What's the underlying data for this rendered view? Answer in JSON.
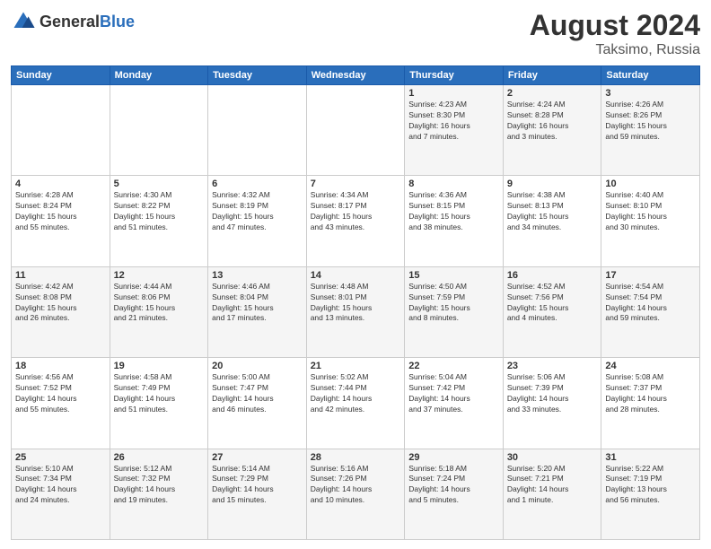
{
  "header": {
    "logo_general": "General",
    "logo_blue": "Blue",
    "month_year": "August 2024",
    "location": "Taksimo, Russia"
  },
  "weekdays": [
    "Sunday",
    "Monday",
    "Tuesday",
    "Wednesday",
    "Thursday",
    "Friday",
    "Saturday"
  ],
  "weeks": [
    [
      {
        "day": "",
        "info": ""
      },
      {
        "day": "",
        "info": ""
      },
      {
        "day": "",
        "info": ""
      },
      {
        "day": "",
        "info": ""
      },
      {
        "day": "1",
        "info": "Sunrise: 4:23 AM\nSunset: 8:30 PM\nDaylight: 16 hours\nand 7 minutes."
      },
      {
        "day": "2",
        "info": "Sunrise: 4:24 AM\nSunset: 8:28 PM\nDaylight: 16 hours\nand 3 minutes."
      },
      {
        "day": "3",
        "info": "Sunrise: 4:26 AM\nSunset: 8:26 PM\nDaylight: 15 hours\nand 59 minutes."
      }
    ],
    [
      {
        "day": "4",
        "info": "Sunrise: 4:28 AM\nSunset: 8:24 PM\nDaylight: 15 hours\nand 55 minutes."
      },
      {
        "day": "5",
        "info": "Sunrise: 4:30 AM\nSunset: 8:22 PM\nDaylight: 15 hours\nand 51 minutes."
      },
      {
        "day": "6",
        "info": "Sunrise: 4:32 AM\nSunset: 8:19 PM\nDaylight: 15 hours\nand 47 minutes."
      },
      {
        "day": "7",
        "info": "Sunrise: 4:34 AM\nSunset: 8:17 PM\nDaylight: 15 hours\nand 43 minutes."
      },
      {
        "day": "8",
        "info": "Sunrise: 4:36 AM\nSunset: 8:15 PM\nDaylight: 15 hours\nand 38 minutes."
      },
      {
        "day": "9",
        "info": "Sunrise: 4:38 AM\nSunset: 8:13 PM\nDaylight: 15 hours\nand 34 minutes."
      },
      {
        "day": "10",
        "info": "Sunrise: 4:40 AM\nSunset: 8:10 PM\nDaylight: 15 hours\nand 30 minutes."
      }
    ],
    [
      {
        "day": "11",
        "info": "Sunrise: 4:42 AM\nSunset: 8:08 PM\nDaylight: 15 hours\nand 26 minutes."
      },
      {
        "day": "12",
        "info": "Sunrise: 4:44 AM\nSunset: 8:06 PM\nDaylight: 15 hours\nand 21 minutes."
      },
      {
        "day": "13",
        "info": "Sunrise: 4:46 AM\nSunset: 8:04 PM\nDaylight: 15 hours\nand 17 minutes."
      },
      {
        "day": "14",
        "info": "Sunrise: 4:48 AM\nSunset: 8:01 PM\nDaylight: 15 hours\nand 13 minutes."
      },
      {
        "day": "15",
        "info": "Sunrise: 4:50 AM\nSunset: 7:59 PM\nDaylight: 15 hours\nand 8 minutes."
      },
      {
        "day": "16",
        "info": "Sunrise: 4:52 AM\nSunset: 7:56 PM\nDaylight: 15 hours\nand 4 minutes."
      },
      {
        "day": "17",
        "info": "Sunrise: 4:54 AM\nSunset: 7:54 PM\nDaylight: 14 hours\nand 59 minutes."
      }
    ],
    [
      {
        "day": "18",
        "info": "Sunrise: 4:56 AM\nSunset: 7:52 PM\nDaylight: 14 hours\nand 55 minutes."
      },
      {
        "day": "19",
        "info": "Sunrise: 4:58 AM\nSunset: 7:49 PM\nDaylight: 14 hours\nand 51 minutes."
      },
      {
        "day": "20",
        "info": "Sunrise: 5:00 AM\nSunset: 7:47 PM\nDaylight: 14 hours\nand 46 minutes."
      },
      {
        "day": "21",
        "info": "Sunrise: 5:02 AM\nSunset: 7:44 PM\nDaylight: 14 hours\nand 42 minutes."
      },
      {
        "day": "22",
        "info": "Sunrise: 5:04 AM\nSunset: 7:42 PM\nDaylight: 14 hours\nand 37 minutes."
      },
      {
        "day": "23",
        "info": "Sunrise: 5:06 AM\nSunset: 7:39 PM\nDaylight: 14 hours\nand 33 minutes."
      },
      {
        "day": "24",
        "info": "Sunrise: 5:08 AM\nSunset: 7:37 PM\nDaylight: 14 hours\nand 28 minutes."
      }
    ],
    [
      {
        "day": "25",
        "info": "Sunrise: 5:10 AM\nSunset: 7:34 PM\nDaylight: 14 hours\nand 24 minutes."
      },
      {
        "day": "26",
        "info": "Sunrise: 5:12 AM\nSunset: 7:32 PM\nDaylight: 14 hours\nand 19 minutes."
      },
      {
        "day": "27",
        "info": "Sunrise: 5:14 AM\nSunset: 7:29 PM\nDaylight: 14 hours\nand 15 minutes."
      },
      {
        "day": "28",
        "info": "Sunrise: 5:16 AM\nSunset: 7:26 PM\nDaylight: 14 hours\nand 10 minutes."
      },
      {
        "day": "29",
        "info": "Sunrise: 5:18 AM\nSunset: 7:24 PM\nDaylight: 14 hours\nand 5 minutes."
      },
      {
        "day": "30",
        "info": "Sunrise: 5:20 AM\nSunset: 7:21 PM\nDaylight: 14 hours\nand 1 minute."
      },
      {
        "day": "31",
        "info": "Sunrise: 5:22 AM\nSunset: 7:19 PM\nDaylight: 13 hours\nand 56 minutes."
      }
    ]
  ]
}
